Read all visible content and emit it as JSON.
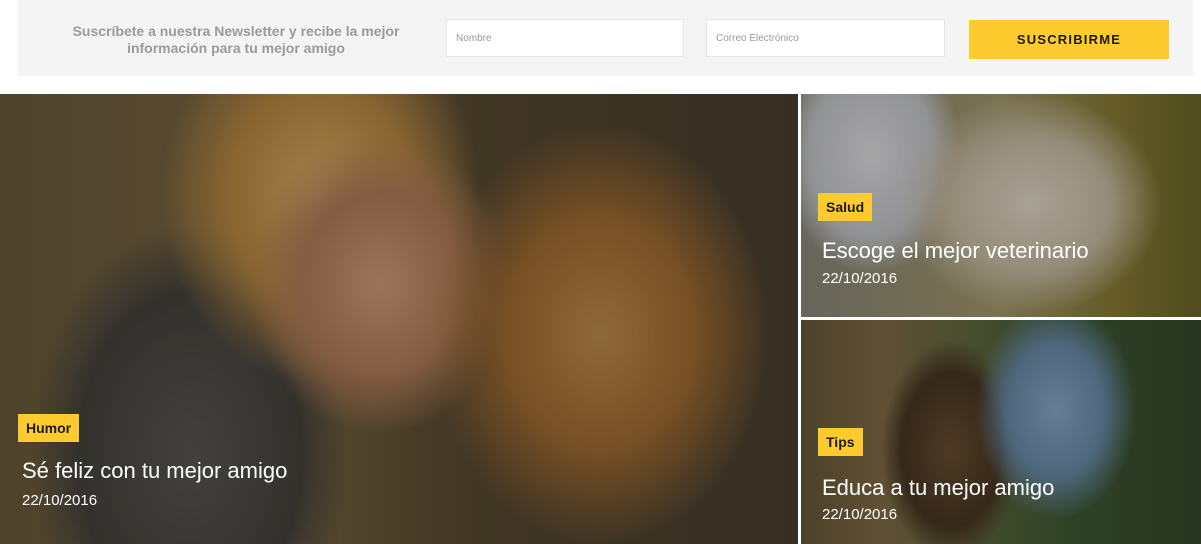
{
  "newsletter": {
    "text": "Suscríbete a nuestra Newsletter y recibe la mejor información para tu mejor amigo",
    "name_placeholder": "Nombre",
    "email_placeholder": "Correo Electrónico",
    "button_label": "SUSCRIBIRME"
  },
  "posts": [
    {
      "category": "Humor",
      "title": "Sé feliz con tu mejor amigo",
      "date": "22/10/2016"
    },
    {
      "category": "Salud",
      "title": "Escoge el mejor veterinario",
      "date": "22/10/2016"
    },
    {
      "category": "Tips",
      "title": "Educa a tu mejor amigo",
      "date": "22/10/2016"
    }
  ],
  "colors": {
    "accent": "#fecb2f",
    "newsletter_bg": "#f4f4f4"
  }
}
